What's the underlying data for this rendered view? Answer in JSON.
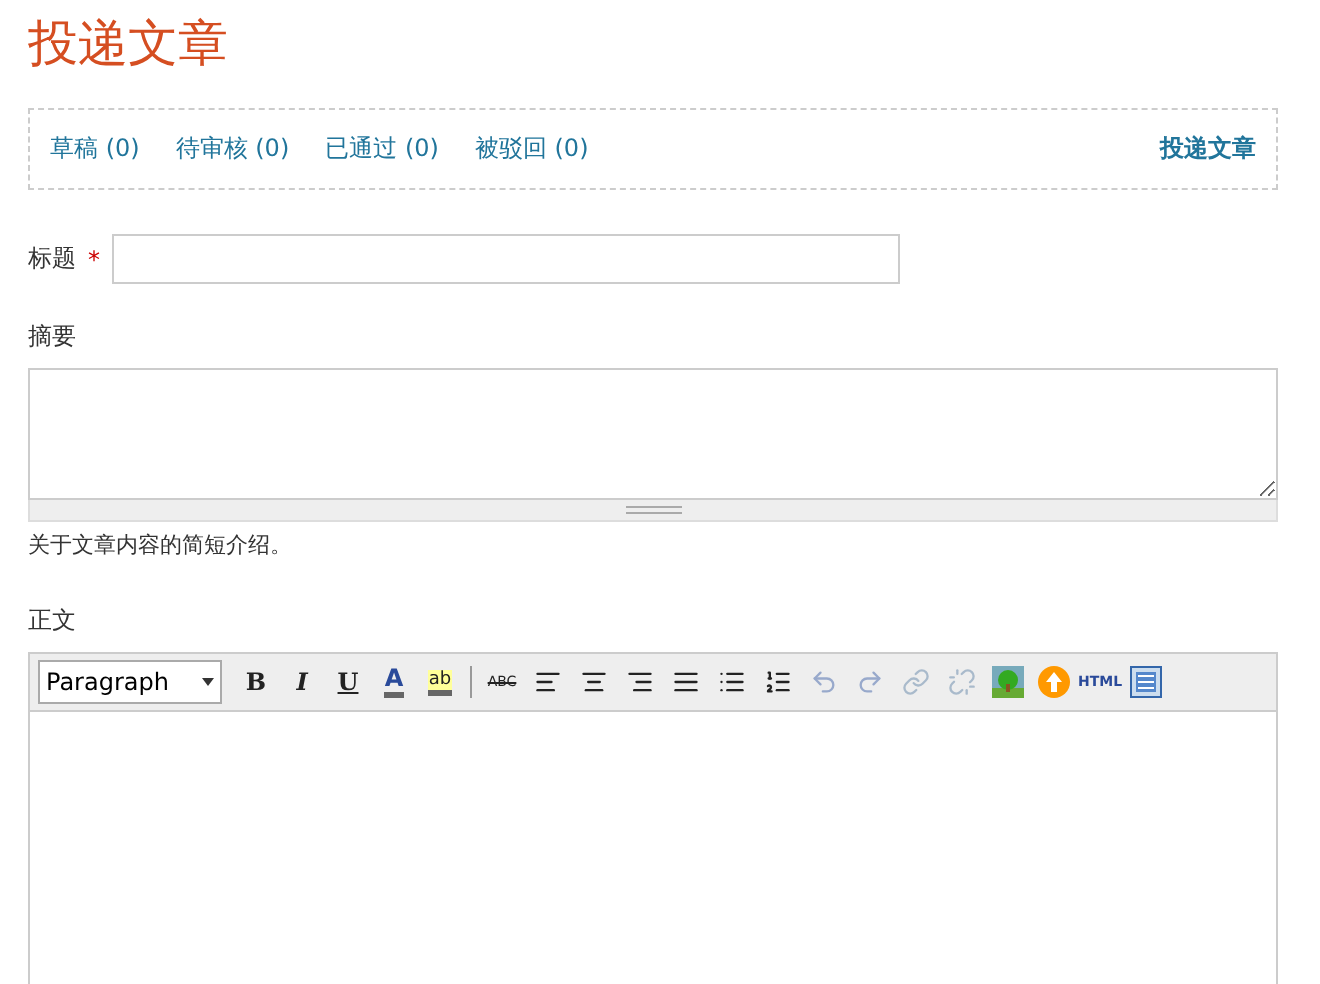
{
  "page_title": "投递文章",
  "nav": {
    "tabs": [
      {
        "label": "草稿 (0)",
        "selected": false
      },
      {
        "label": "待审核 (0)",
        "selected": false
      },
      {
        "label": "已通过 (0)",
        "selected": false
      },
      {
        "label": "被驳回 (0)",
        "selected": false
      }
    ],
    "action": "投递文章"
  },
  "title_field": {
    "label": "标题",
    "required_mark": "*"
  },
  "summary_field": {
    "label": "摘要",
    "hint": "关于文章内容的简短介绍。"
  },
  "body_field": {
    "label": "正文",
    "format_select": "Paragraph",
    "tools": [
      {
        "kind": "bold",
        "text": "B",
        "disabled": false
      },
      {
        "kind": "italic",
        "text": "I",
        "disabled": false
      },
      {
        "kind": "underline",
        "text": "U",
        "disabled": false
      },
      {
        "kind": "textcolor",
        "text": "A",
        "disabled": false
      },
      {
        "kind": "highlight",
        "text": "ab",
        "disabled": false
      },
      {
        "kind": "separator"
      },
      {
        "kind": "strike",
        "text": "ABC",
        "disabled": false
      },
      {
        "kind": "alignleft",
        "disabled": false
      },
      {
        "kind": "aligncenter",
        "disabled": false
      },
      {
        "kind": "alignright",
        "disabled": false
      },
      {
        "kind": "justify",
        "disabled": false
      },
      {
        "kind": "bullets",
        "disabled": false
      },
      {
        "kind": "numbers",
        "disabled": false
      },
      {
        "kind": "undo",
        "disabled": true
      },
      {
        "kind": "redo",
        "disabled": true
      },
      {
        "kind": "link",
        "disabled": true
      },
      {
        "kind": "unlink",
        "disabled": true
      },
      {
        "kind": "image",
        "disabled": false
      },
      {
        "kind": "upload",
        "disabled": false
      },
      {
        "kind": "html",
        "text": "HTML",
        "disabled": false
      },
      {
        "kind": "fullscreen",
        "disabled": false
      }
    ]
  }
}
